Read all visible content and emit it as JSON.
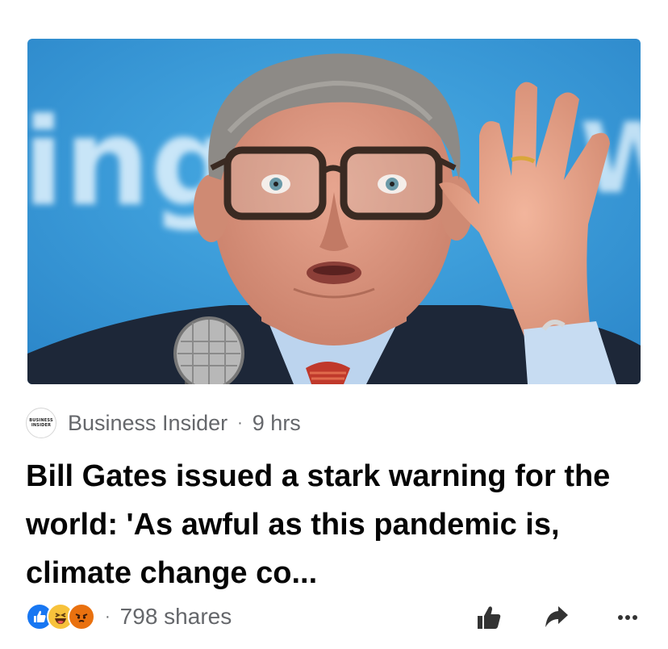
{
  "image": {
    "background_text_left": "ing",
    "background_text_right": "W"
  },
  "source": {
    "logo_line1": "BUSINESS",
    "logo_line2": "INSIDER",
    "name": "Business Insider",
    "separator": "·",
    "time": "9 hrs"
  },
  "headline": "Bill Gates issued a stark warning for the world: 'As awful as this pandemic is, climate change co...",
  "footer": {
    "reactions": [
      "like-icon",
      "haha-icon",
      "angry-icon"
    ],
    "separator": "·",
    "shares": "798 shares",
    "actions": [
      "like-button",
      "share-button",
      "more-button"
    ]
  },
  "colors": {
    "hero_background": "#3a9ad9",
    "like_blue": "#1877f2",
    "haha_yellow": "#f7c23b",
    "angry_orange": "#e9710f",
    "secondary_text": "#65676b",
    "headline_text": "#050505"
  }
}
